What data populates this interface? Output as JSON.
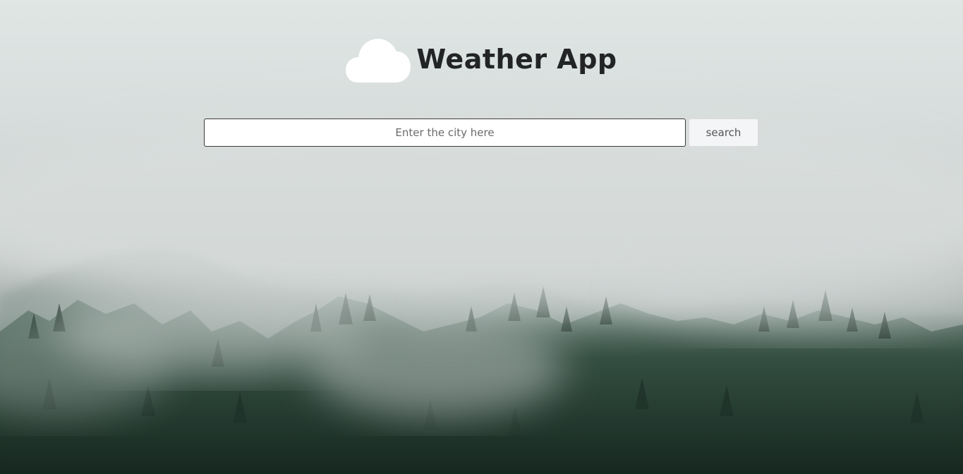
{
  "header": {
    "icon": "cloud-icon",
    "title": "Weather App"
  },
  "search": {
    "placeholder": "Enter the city here",
    "value": "",
    "button_label": "search"
  },
  "colors": {
    "title": "#222426",
    "cloud": "#ffffff",
    "forest": "#1c2d25",
    "fog": "#d7dddc"
  }
}
